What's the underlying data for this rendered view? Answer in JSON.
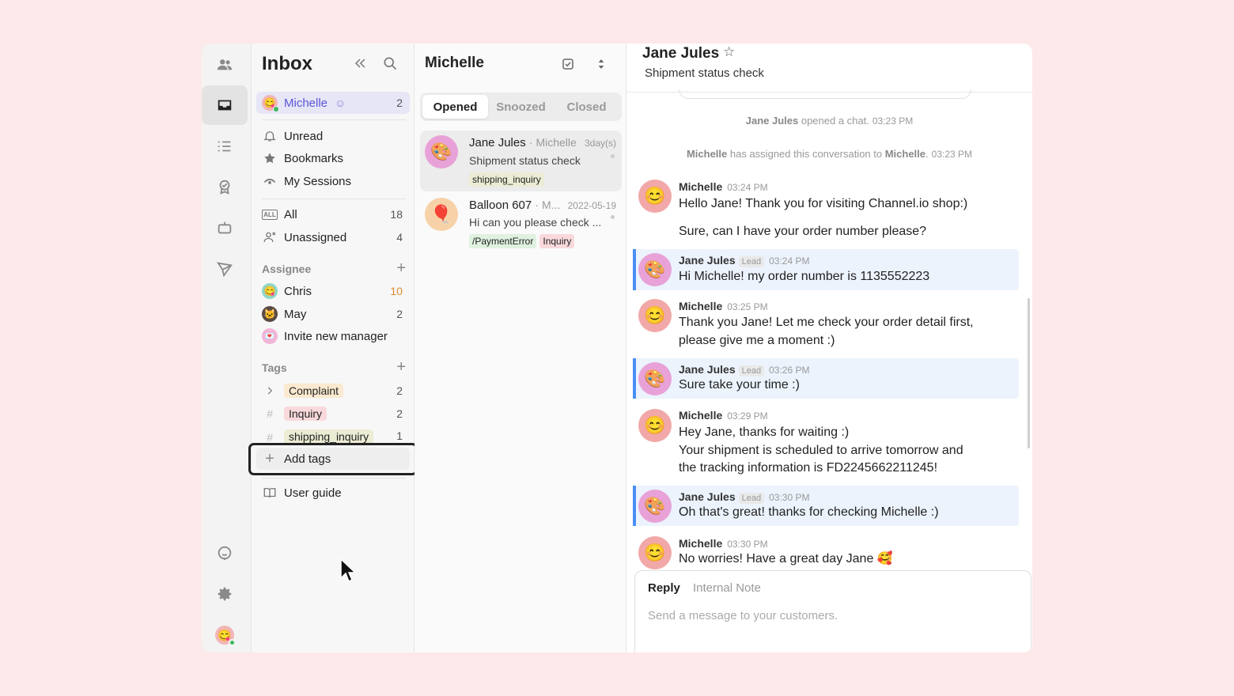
{
  "colors": {
    "accent": "#5b56d6",
    "user_bar": "#4a8ff5",
    "background": "#fde8ea"
  },
  "rail": {
    "items": [
      "contacts-icon",
      "inbox-icon",
      "list-icon",
      "badge-icon",
      "bot-icon",
      "send-icon",
      "support-icon",
      "settings-icon",
      "user-avatar"
    ]
  },
  "sidebar": {
    "title": "Inbox",
    "me": {
      "name": "Michelle",
      "count": "2"
    },
    "filters": [
      {
        "label": "Unread"
      },
      {
        "label": "Bookmarks"
      },
      {
        "label": "My Sessions"
      }
    ],
    "all": {
      "label": "All",
      "icon_text": "ALL",
      "count": "18"
    },
    "unassigned": {
      "label": "Unassigned",
      "count": "4"
    },
    "assignee_title": "Assignee",
    "assignees": [
      {
        "name": "Chris",
        "count": "10"
      },
      {
        "name": "May",
        "count": "2"
      }
    ],
    "invite_label": "Invite new manager",
    "tags_title": "Tags",
    "tags": [
      {
        "name": "Complaint",
        "count": "2",
        "color": "#fbe9d0"
      },
      {
        "name": "Inquiry",
        "count": "2",
        "color": "#f9d9dc"
      },
      {
        "name": "shipping_inquiry",
        "count": "1",
        "color": "#ececd4"
      }
    ],
    "add_tags_label": "Add tags",
    "user_guide_label": "User guide"
  },
  "list": {
    "title": "Michelle",
    "tabs": [
      "Opened",
      "Snoozed",
      "Closed"
    ],
    "conversations": [
      {
        "name": "Jane Jules",
        "assignee": "· Michelle",
        "date": "3day(s)",
        "preview": "Shipment status check",
        "avatar": "🎨",
        "tags": [
          {
            "label": "shipping_inquiry",
            "color": "#ececd4"
          }
        ]
      },
      {
        "name": "Balloon 607",
        "assignee": "· M...",
        "date": "2022-05-19",
        "preview": "Hi can you please check ...",
        "avatar": "🎈",
        "tags": [
          {
            "label": "/PaymentError",
            "color": "#dff1df"
          },
          {
            "label": "Inquiry",
            "color": "#f9d9dc"
          }
        ]
      }
    ]
  },
  "chat": {
    "contact": "Jane Jules",
    "subject": "Shipment status check",
    "system": [
      {
        "who": "Jane Jules",
        "text": " opened a chat.",
        "time": "03:23 PM"
      },
      {
        "who": "Michelle",
        "text": " has assigned this conversation to ",
        "who2": "Michelle",
        "end": ".",
        "time": "03:23 PM"
      }
    ],
    "messages": [
      {
        "author": "Michelle",
        "time": "03:24 PM",
        "lead": "",
        "avatar": "😊",
        "lines": [
          "Hello Jane! Thank you for visiting Channel.io shop:)"
        ],
        "extra": "Sure, can I have your order number please?"
      },
      {
        "author": "Jane Jules",
        "time": "03:24 PM",
        "lead": "Lead",
        "avatar": "🎨",
        "lines": [
          "Hi Michelle! my order number is 1135552223"
        ]
      },
      {
        "author": "Michelle",
        "time": "03:25 PM",
        "lead": "",
        "avatar": "😊",
        "lines": [
          "Thank you Jane! Let me check your order detail first,",
          "please give me a moment :)"
        ]
      },
      {
        "author": "Jane Jules",
        "time": "03:26 PM",
        "lead": "Lead",
        "avatar": "🎨",
        "lines": [
          "Sure take your time :)"
        ]
      },
      {
        "author": "Michelle",
        "time": "03:29 PM",
        "lead": "",
        "avatar": "😊",
        "lines": [
          "Hey Jane, thanks for waiting :)",
          "Your shipment is scheduled to arrive tomorrow and",
          "the tracking information is FD2245662211245!"
        ]
      },
      {
        "author": "Jane Jules",
        "time": "03:30 PM",
        "lead": "Lead",
        "avatar": "🎨",
        "lines": [
          "Oh that's great! thanks for checking Michelle :)"
        ]
      },
      {
        "author": "Michelle",
        "time": "03:30 PM",
        "lead": "",
        "avatar": "😊",
        "lines": [
          "No worries! Have a great day Jane 🥰"
        ]
      }
    ],
    "composer": {
      "tab_reply": "Reply",
      "tab_note": "Internal Note",
      "placeholder": "Send a message to your customers."
    }
  }
}
